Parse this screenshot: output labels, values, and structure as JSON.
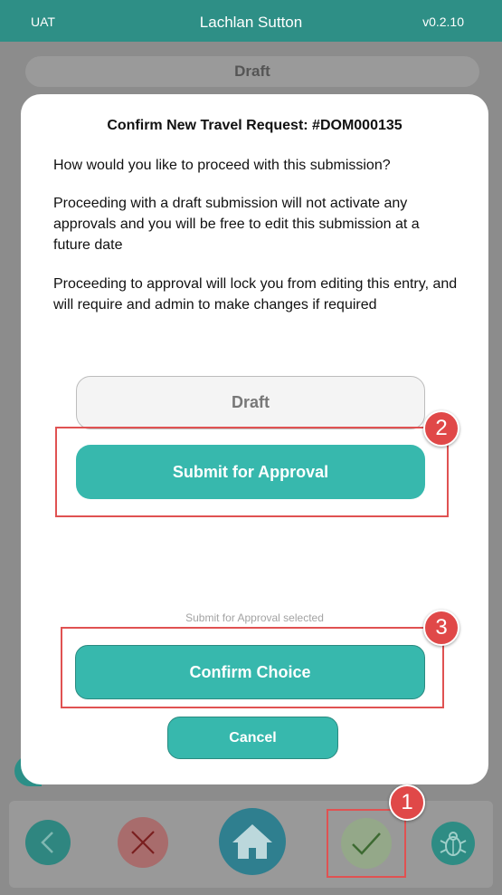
{
  "header": {
    "env": "UAT",
    "user": "Lachlan Sutton",
    "version": "v0.2.10"
  },
  "status_pill": "Draft",
  "modal": {
    "title": "Confirm New Travel Request: #DOM000135",
    "question": "How would you like to proceed with this submission?",
    "draft_info": "Proceeding with a draft submission will not activate any approvals and you will be free to edit this submission at a future date",
    "approval_info": "Proceeding to approval will lock you from editing this entry, and will require and admin to make changes if required",
    "draft_button": "Draft",
    "submit_button": "Submit for Approval",
    "selected_label": "Submit for Approval selected",
    "confirm_button": "Confirm Choice",
    "cancel_button": "Cancel"
  },
  "bottom_nav": [
    {
      "icon": "chevron-left-icon"
    },
    {
      "icon": "close-icon"
    },
    {
      "icon": "home-icon"
    },
    {
      "icon": "check-icon"
    },
    {
      "icon": "bug-icon"
    }
  ],
  "annotations": {
    "badge_1": "1",
    "badge_2": "2",
    "badge_3": "3"
  },
  "colors": {
    "accent": "#37b8ad",
    "header": "#2e8f86",
    "highlight": "#e05252"
  }
}
